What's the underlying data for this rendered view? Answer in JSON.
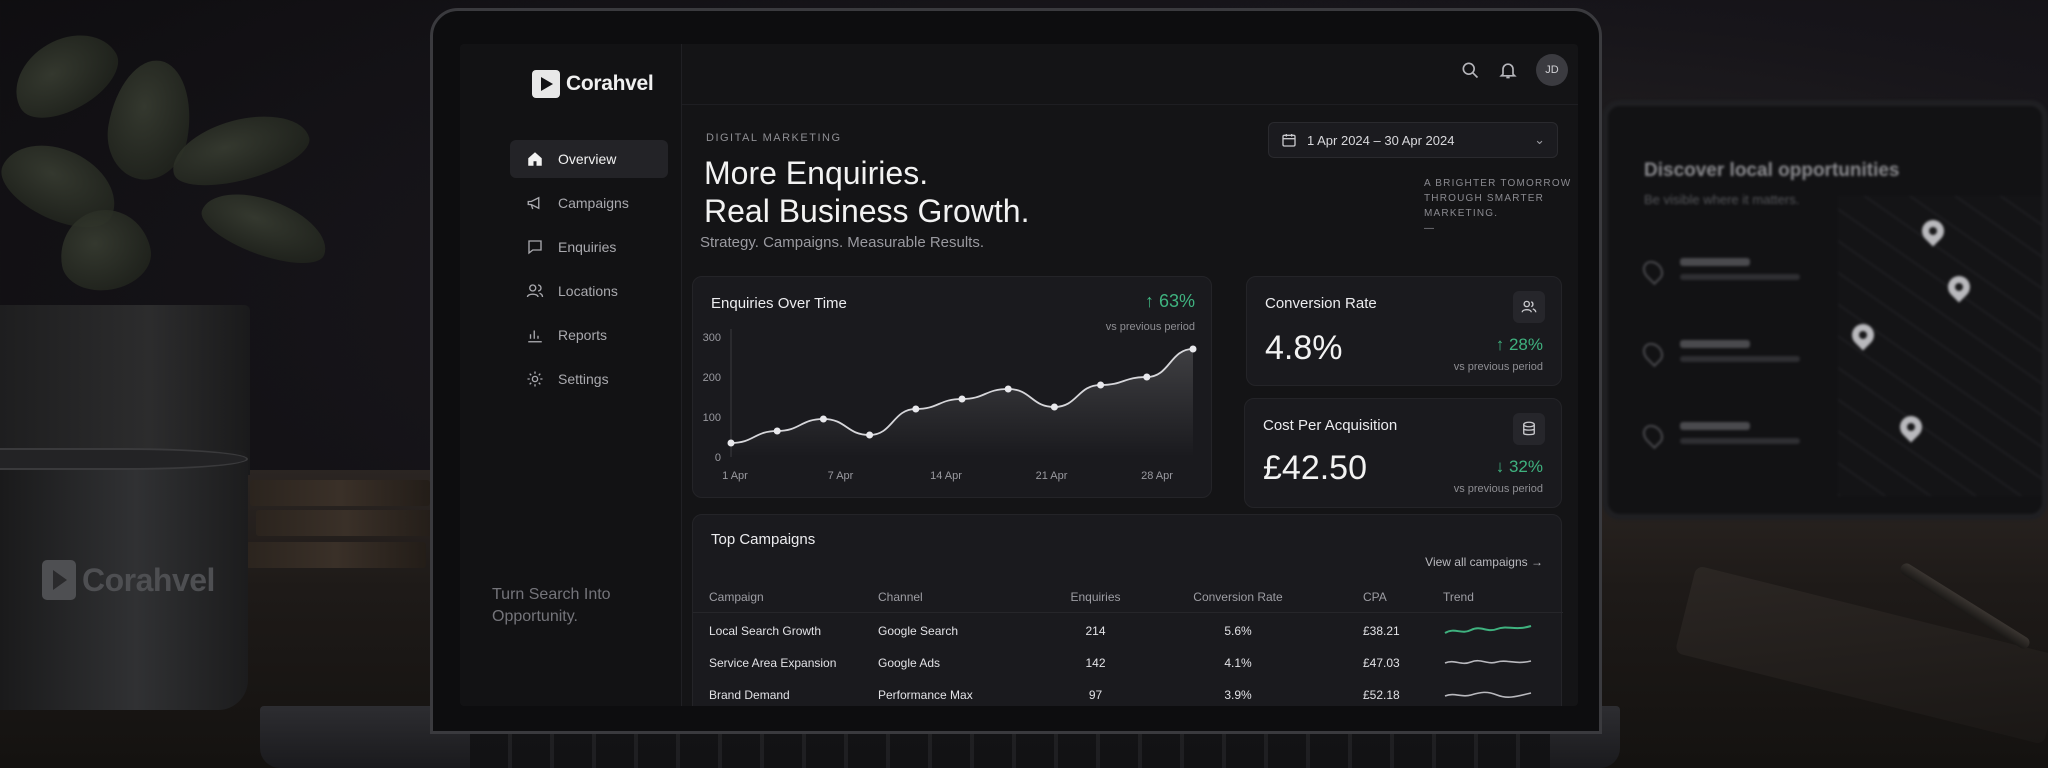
{
  "brand": {
    "name": "Corahvel"
  },
  "mug": {
    "logo_text": "Corahvel"
  },
  "tablet": {
    "title": "Discover local opportunities",
    "subtitle": "Be visible where it matters."
  },
  "sidebar": {
    "items": [
      {
        "label": "Overview",
        "icon": "home-icon",
        "active": true
      },
      {
        "label": "Campaigns",
        "icon": "megaphone-icon",
        "active": false
      },
      {
        "label": "Enquiries",
        "icon": "chat-icon",
        "active": false
      },
      {
        "label": "Locations",
        "icon": "users-icon",
        "active": false
      },
      {
        "label": "Reports",
        "icon": "bar-chart-icon",
        "active": false
      },
      {
        "label": "Settings",
        "icon": "gear-icon",
        "active": false
      }
    ],
    "tagline": "Turn Search Into Opportunity."
  },
  "topbar": {
    "avatar_initials": "JD"
  },
  "hero": {
    "eyebrow": "DIGITAL MARKETING",
    "headline_line1": "More Enquiries.",
    "headline_line2": "Real Business Growth.",
    "subhead": "Strategy. Campaigns. Measurable Results."
  },
  "date_range": {
    "value": "1 Apr 2024 – 30 Apr 2024"
  },
  "slogan": "A BRIGHTER TOMORROW THROUGH SMARTER MARKETING.",
  "enquiries_card": {
    "title": "Enquiries Over Time",
    "delta": "↑ 63%",
    "delta_sub": "vs previous period"
  },
  "conversion_card": {
    "title": "Conversion Rate",
    "value": "4.8%",
    "delta": "↑ 28%",
    "delta_sub": "vs previous period"
  },
  "cpa_card": {
    "title": "Cost Per Acquisition",
    "value": "£42.50",
    "delta": "↓ 32%",
    "delta_sub": "vs previous period"
  },
  "colors": {
    "positive": "#3fb27f",
    "background": "#141416",
    "card": "#1a1a1e"
  },
  "campaigns": {
    "title": "Top Campaigns",
    "view_all": "View all campaigns →",
    "columns": [
      "Campaign",
      "Channel",
      "Enquiries",
      "Conversion Rate",
      "CPA",
      "Trend"
    ],
    "rows": [
      {
        "campaign": "Local Search Growth",
        "channel": "Google Search",
        "enquiries": "214",
        "conversion": "5.6%",
        "cpa": "£38.21",
        "trend": "up"
      },
      {
        "campaign": "Service Area Expansion",
        "channel": "Google Ads",
        "enquiries": "142",
        "conversion": "4.1%",
        "cpa": "£47.03",
        "trend": "flat"
      },
      {
        "campaign": "Brand Demand",
        "channel": "Performance Max",
        "enquiries": "97",
        "conversion": "3.9%",
        "cpa": "£52.18",
        "trend": "flat"
      }
    ]
  },
  "chart_data": {
    "type": "line",
    "title": "Enquiries Over Time",
    "x_tick_labels": [
      "1 Apr",
      "7 Apr",
      "14 Apr",
      "21 Apr",
      "28 Apr"
    ],
    "y_ticks": [
      0,
      100,
      200,
      300
    ],
    "ylim": [
      0,
      300
    ],
    "x": [
      "1 Apr",
      "4 Apr",
      "7 Apr",
      "10 Apr",
      "13 Apr",
      "16 Apr",
      "19 Apr",
      "22 Apr",
      "25 Apr",
      "28 Apr",
      "30 Apr"
    ],
    "values": [
      35,
      65,
      95,
      55,
      120,
      145,
      170,
      125,
      180,
      200,
      270
    ],
    "grid": false
  }
}
